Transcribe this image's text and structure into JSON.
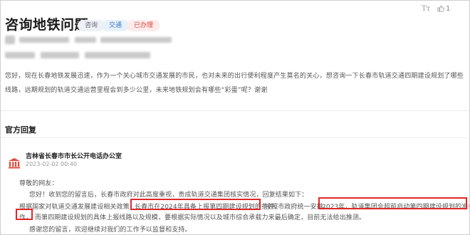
{
  "header": {
    "title": "咨询地铁问题",
    "tags": [
      "咨询",
      "交通",
      "已办理"
    ],
    "font_icon": "Tт",
    "like_icon": "like-icon",
    "like_count": "1"
  },
  "question": {
    "text": "您好，现在长春地铁发展迅速，作为一个关心城市交通发展的市民，也对未来的出行便利程度产生莫名的关心，想咨询一下长春市轨道交通四期建设规划了哪些线路，远期规划的轨道交通运营里程会到多少公里，未来地铁规划会有哪些“彩蛋”呢？谢谢"
  },
  "official": {
    "heading": "官方回复",
    "org_name": "吉林省长春市市长公开电话办公室",
    "date": "2023-02-02 00:40",
    "reply": {
      "greeting": "尊敬的网友：",
      "line2": "您好！收到您的留言后，长春市政府对此高度重视，责成轨道交通集团核实情况，回复结果如下：",
      "line3_pre": "根据国家对轨道交通发展建设相关政策，",
      "line3_hl1": "长春市在2024年具备上报第四期建设规划的条件。",
      "line3_mid": "按照市政府统一安排，",
      "line3_hl2": "2023年，轨道集团会超前启动第四期建设规划的准备工",
      "line4_hl": "作，",
      "line4_rest": "而第四期建设规划的具体上报线路以及规模，要根据实际情况以及城市综合承载力来最后确定，目前无法给出推测。",
      "line5": "感谢您的留言，欢迎继续对我们的工作予以监督和支持。"
    }
  },
  "colors": {
    "highlight": "#e0282a",
    "tag_status": "#e0453a",
    "tag_category": "#3a78c4"
  }
}
